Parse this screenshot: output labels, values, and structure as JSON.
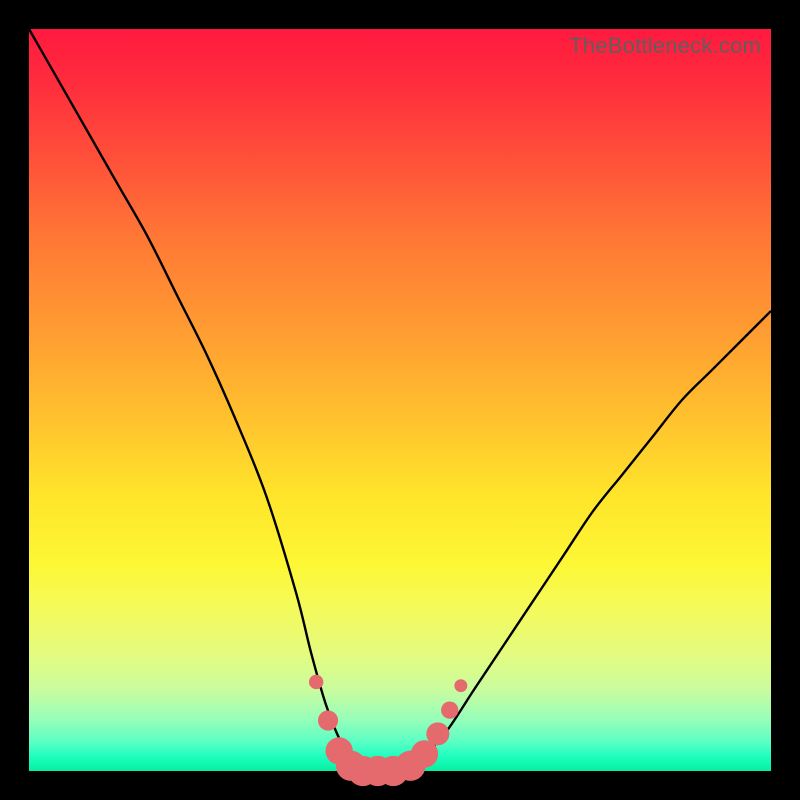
{
  "watermark": "TheBottleneck.com",
  "colors": {
    "frame": "#000000",
    "curve": "#000000",
    "marker_fill": "#e46a6e",
    "marker_stroke": "#e46a6e"
  },
  "chart_data": {
    "type": "line",
    "title": "",
    "xlabel": "",
    "ylabel": "",
    "xlim": [
      0,
      100
    ],
    "ylim": [
      0,
      100
    ],
    "grid": false,
    "legend": false,
    "series": [
      {
        "name": "bottleneck-curve",
        "x": [
          0,
          4,
          8,
          12,
          16,
          20,
          24,
          28,
          32,
          36,
          38,
          40,
          42,
          44,
          46,
          48,
          50,
          52,
          56,
          60,
          64,
          68,
          72,
          76,
          80,
          84,
          88,
          92,
          96,
          100
        ],
        "y": [
          100,
          93,
          86,
          79,
          72,
          64,
          56,
          47,
          37,
          24,
          16,
          9,
          4,
          1,
          0,
          0,
          0,
          1,
          5,
          11,
          17,
          23,
          29,
          35,
          40,
          45,
          50,
          54,
          58,
          62
        ]
      }
    ],
    "markers": {
      "name": "valley-markers",
      "points": [
        {
          "x": 38.7,
          "y": 12.0,
          "r": 1.0
        },
        {
          "x": 40.3,
          "y": 6.8,
          "r": 1.4
        },
        {
          "x": 41.8,
          "y": 2.7,
          "r": 1.9
        },
        {
          "x": 43.4,
          "y": 0.7,
          "r": 2.1
        },
        {
          "x": 45.0,
          "y": 0.0,
          "r": 2.1
        },
        {
          "x": 47.0,
          "y": 0.0,
          "r": 2.1
        },
        {
          "x": 49.1,
          "y": 0.0,
          "r": 2.1
        },
        {
          "x": 51.4,
          "y": 0.7,
          "r": 2.1
        },
        {
          "x": 53.3,
          "y": 2.3,
          "r": 1.9
        },
        {
          "x": 55.1,
          "y": 5.0,
          "r": 1.6
        },
        {
          "x": 56.7,
          "y": 8.2,
          "r": 1.2
        },
        {
          "x": 58.2,
          "y": 11.5,
          "r": 0.9
        }
      ]
    }
  }
}
